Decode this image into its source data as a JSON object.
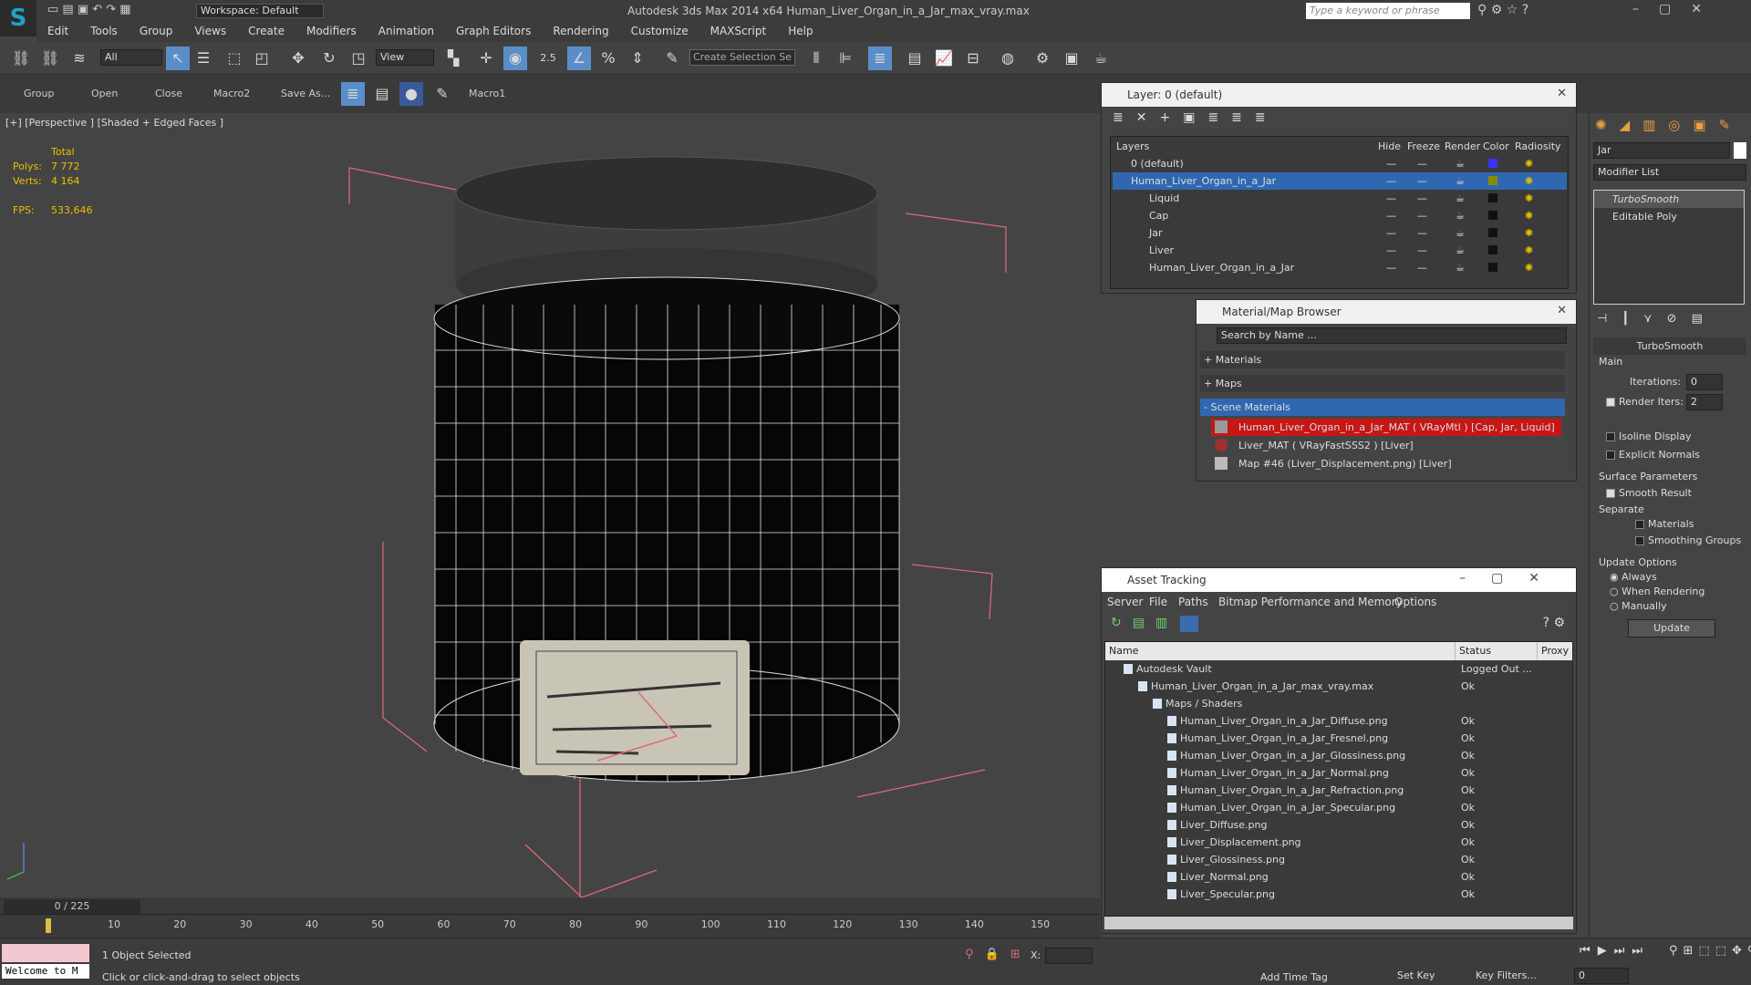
{
  "app": {
    "title": "Autodesk 3ds Max  2014 x64     Human_Liver_Organ_in_a_Jar_max_vray.max",
    "workspace": "Workspace: Default",
    "search_placeholder": "Type a keyword or phrase"
  },
  "menu": [
    "Edit",
    "Tools",
    "Group",
    "Views",
    "Create",
    "Modifiers",
    "Animation",
    "Graph Editors",
    "Rendering",
    "Customize",
    "MAXScript",
    "Help"
  ],
  "toolbar": {
    "filter": "All",
    "refcoord": "View",
    "snap": "2.5",
    "selection_set": "Create Selection Se"
  },
  "toolbar2": {
    "items": [
      "Group",
      "Open",
      "Close",
      "Macro2",
      "Save As...",
      "Macro1"
    ]
  },
  "viewport": {
    "label": "[+] [Perspective ] [Shaded + Edged Faces ]",
    "stats_total": "Total",
    "polys_label": "Polys:",
    "polys": "7 772",
    "verts_label": "Verts:",
    "verts": "4 164",
    "fps_label": "FPS:",
    "fps": "533,646"
  },
  "layer_dialog": {
    "title": "Layer: 0 (default)",
    "columns": [
      "Layers",
      "Hide",
      "Freeze",
      "Render",
      "Color",
      "Radiosity"
    ],
    "rows": [
      {
        "name": "0 (default)",
        "color": "#3535ff"
      },
      {
        "name": "Human_Liver_Organ_in_a_Jar",
        "color": "#8a8a00"
      },
      {
        "name": "Liquid",
        "color": "#111111"
      },
      {
        "name": "Cap",
        "color": "#111111"
      },
      {
        "name": "Jar",
        "color": "#111111"
      },
      {
        "name": "Liver",
        "color": "#111111"
      },
      {
        "name": "Human_Liver_Organ_in_a_Jar",
        "color": "#111111"
      }
    ]
  },
  "material_browser": {
    "title": "Material/Map Browser",
    "search_placeholder": "Search by Name ...",
    "sections": [
      "+ Materials",
      "+ Maps",
      "- Scene Materials"
    ],
    "items": [
      "Human_Liver_Organ_in_a_Jar_MAT  ( VRayMtl )  [Cap, Jar, Liquid]",
      "Liver_MAT  ( VRayFastSSS2 )  [Liver]",
      "Map #46 (Liver_Displacement.png)  [Liver]"
    ]
  },
  "asset_tracking": {
    "title": "Asset Tracking",
    "menu": [
      "Server",
      "File",
      "Paths",
      "Bitmap Performance and Memory",
      "Options"
    ],
    "columns": [
      "Name",
      "Status",
      "Proxy"
    ],
    "rows": [
      {
        "name": "Autodesk Vault",
        "status": "Logged Out ...",
        "indent": 0
      },
      {
        "name": "Human_Liver_Organ_in_a_Jar_max_vray.max",
        "status": "Ok",
        "indent": 1
      },
      {
        "name": "Maps / Shaders",
        "status": "",
        "indent": 2
      },
      {
        "name": "Human_Liver_Organ_in_a_Jar_Diffuse.png",
        "status": "Ok",
        "indent": 3
      },
      {
        "name": "Human_Liver_Organ_in_a_Jar_Fresnel.png",
        "status": "Ok",
        "indent": 3
      },
      {
        "name": "Human_Liver_Organ_in_a_Jar_Glossiness.png",
        "status": "Ok",
        "indent": 3
      },
      {
        "name": "Human_Liver_Organ_in_a_Jar_Normal.png",
        "status": "Ok",
        "indent": 3
      },
      {
        "name": "Human_Liver_Organ_in_a_Jar_Refraction.png",
        "status": "Ok",
        "indent": 3
      },
      {
        "name": "Human_Liver_Organ_in_a_Jar_Specular.png",
        "status": "Ok",
        "indent": 3
      },
      {
        "name": "Liver_Diffuse.png",
        "status": "Ok",
        "indent": 3
      },
      {
        "name": "Liver_Displacement.png",
        "status": "Ok",
        "indent": 3
      },
      {
        "name": "Liver_Glossiness.png",
        "status": "Ok",
        "indent": 3
      },
      {
        "name": "Liver_Normal.png",
        "status": "Ok",
        "indent": 3
      },
      {
        "name": "Liver_Specular.png",
        "status": "Ok",
        "indent": 3
      }
    ]
  },
  "command_panel": {
    "object_name": "Jar",
    "modifier_list": "Modifier List",
    "stack": [
      "TurboSmooth",
      "Editable Poly"
    ],
    "rollout": "TurboSmooth",
    "main": "Main",
    "iterations_label": "Iterations:",
    "iterations": "0",
    "render_iters_label": "Render Iters:",
    "render_iters": "2",
    "isoline": "Isoline Display",
    "explicit_normals": "Explicit Normals",
    "surface_params": "Surface Parameters",
    "smooth_result": "Smooth Result",
    "separate": "Separate",
    "materials": "Materials",
    "smoothing_groups": "Smoothing Groups",
    "update_options": "Update Options",
    "always": "Always",
    "when_rendering": "When Rendering",
    "manually": "Manually",
    "update_button": "Update"
  },
  "timeline": {
    "frame": "0 / 225",
    "ticks": [
      "0",
      "10",
      "20",
      "30",
      "40",
      "50",
      "60",
      "70",
      "80",
      "90",
      "100",
      "110",
      "120",
      "130",
      "140",
      "150"
    ]
  },
  "status": {
    "welcome": "Welcome to M",
    "selected": "1 Object Selected",
    "prompt": "Click or click-and-drag to select objects",
    "x_label": "X:",
    "add_time_tag": "Add Time Tag",
    "set_key": "Set Key",
    "key_filters": "Key Filters...",
    "frame_value": "0"
  }
}
